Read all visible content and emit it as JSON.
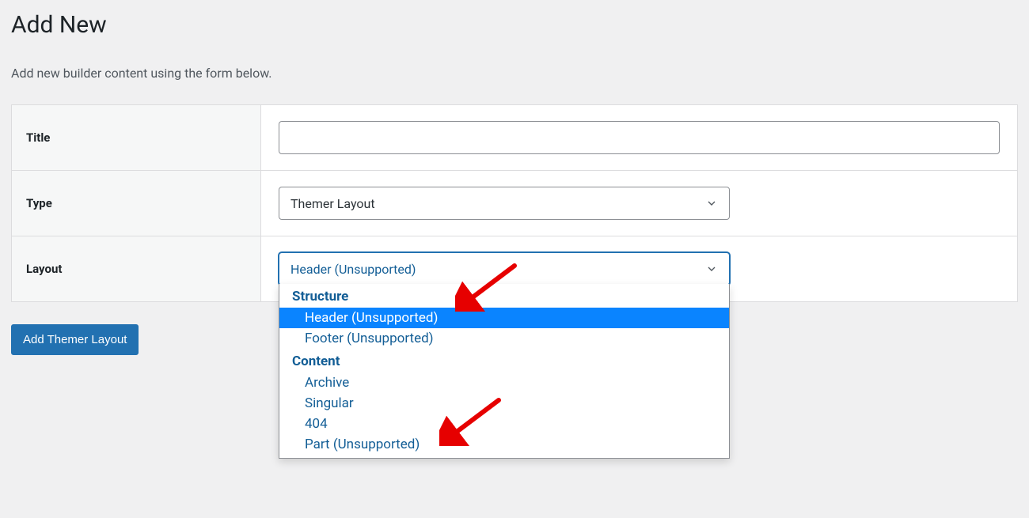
{
  "page": {
    "title": "Add New",
    "subtitle": "Add new builder content using the form below."
  },
  "form": {
    "title_label": "Title",
    "title_value": "",
    "type_label": "Type",
    "type_value": "Themer Layout",
    "layout_label": "Layout",
    "layout_value": "Header (Unsupported)"
  },
  "dropdown": {
    "group1_label": "Structure",
    "group1_opts": {
      "header": "Header (Unsupported)",
      "footer": "Footer (Unsupported)"
    },
    "group2_label": "Content",
    "group2_opts": {
      "archive": "Archive",
      "singular": "Singular",
      "notfound": "404",
      "part": "Part (Unsupported)"
    }
  },
  "button": {
    "submit": "Add Themer Layout"
  },
  "colors": {
    "accent": "#2271b1",
    "highlight": "#0a84ff",
    "arrow": "#e60000"
  }
}
